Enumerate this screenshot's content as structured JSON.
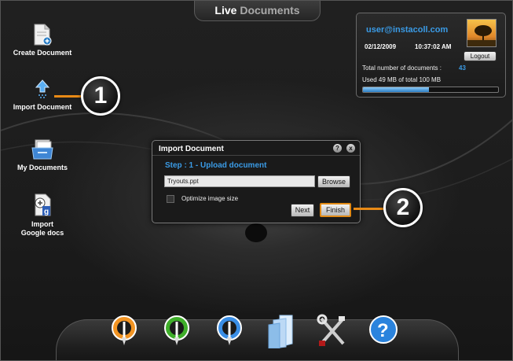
{
  "app_title": {
    "part1": "Live",
    "part2": "Documents"
  },
  "desktop": [
    {
      "label": "Create Document"
    },
    {
      "label": "Import Document"
    },
    {
      "label": "My Documents"
    },
    {
      "label": "Import Google docs"
    }
  ],
  "user_panel": {
    "email": "user@instacoll.com",
    "date": "02/12/2009",
    "time": "10:37:02 AM",
    "logout_label": "Logout",
    "docs_label": "Total number of documents :",
    "docs_count": "43",
    "storage_label": "Used 49 MB of total 100 MB",
    "storage_used_fraction": 0.49
  },
  "dialog": {
    "title": "Import Document",
    "help_label": "?",
    "close_label": "x",
    "step_title": "Step : 1 - Upload document",
    "file_value": "Tryouts.ppt",
    "browse_label": "Browse",
    "optimize_label": "Optimize image size",
    "next_label": "Next",
    "finish_label": "Finish"
  },
  "callouts": {
    "one": "1",
    "two": "2"
  },
  "colors": {
    "accent_blue": "#3a9be6",
    "highlight_orange": "#e88a16"
  },
  "dock": {
    "icons": [
      "orange-pen-icon",
      "green-pen-icon",
      "blue-pen-icon",
      "documents-icon",
      "tools-icon",
      "help-icon"
    ]
  }
}
